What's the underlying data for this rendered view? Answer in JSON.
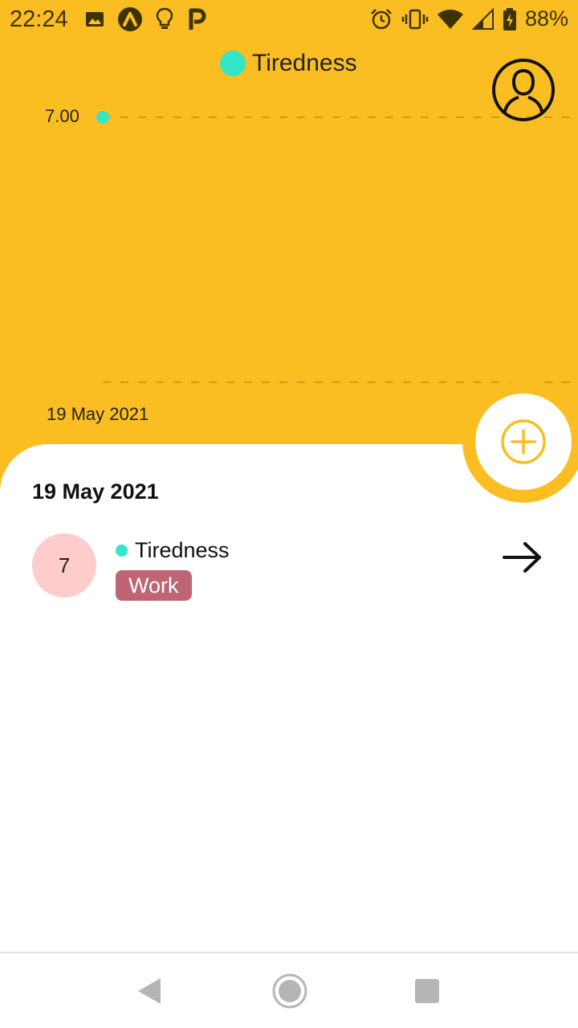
{
  "status_bar": {
    "time": "22:24",
    "battery": "88%",
    "left_icons": [
      "image-icon",
      "lambda-app-icon",
      "lightbulb-icon",
      "p-app-icon"
    ],
    "right_icons": [
      "alarm-icon",
      "vibrate-icon",
      "wifi-icon",
      "signal-icon",
      "battery-charging-icon"
    ]
  },
  "chart": {
    "legend_label": "Tiredness",
    "y_tick": "7.00",
    "x_tick": "19 May 2021",
    "series_color": "#33e6c8",
    "background_color": "#fbbe22"
  },
  "chart_data": {
    "type": "line",
    "series": [
      {
        "name": "Tiredness",
        "x": [
          "19 May 2021"
        ],
        "values": [
          7
        ]
      }
    ],
    "y_ticks": [
      "7.00"
    ],
    "x_ticks": [
      "19 May 2021"
    ],
    "grid": true,
    "legend_placement": "top-center"
  },
  "icons": {
    "profile": "profile-icon",
    "add": "add-circle-icon",
    "arrow": "arrow-right-icon"
  },
  "entries_section": {
    "date_heading": "19 May 2021",
    "entries": [
      {
        "value": "7",
        "metric": "Tiredness",
        "tag": "Work",
        "value_bg": "#ffcccc",
        "tag_color": "#be6472"
      }
    ]
  },
  "nav_bar": {
    "buttons": [
      "back-icon",
      "home-icon",
      "recents-icon"
    ]
  }
}
